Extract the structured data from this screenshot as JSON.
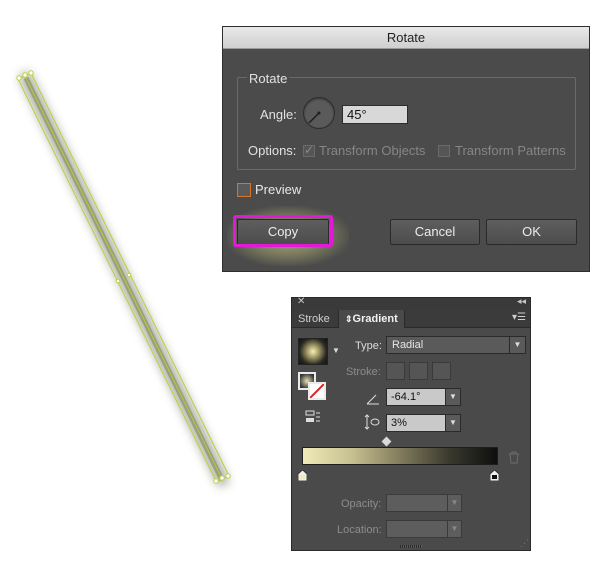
{
  "rotate_dialog": {
    "title": "Rotate",
    "group_label": "Rotate",
    "angle_label": "Angle:",
    "angle_value": "45°",
    "options_label": "Options:",
    "transform_objects_label": "Transform Objects",
    "transform_objects_checked": true,
    "transform_patterns_label": "Transform Patterns",
    "transform_patterns_checked": false,
    "preview_label": "Preview",
    "preview_checked": false,
    "copy_label": "Copy",
    "cancel_label": "Cancel",
    "ok_label": "OK",
    "highlight_color": "#e21ad8"
  },
  "gradient_panel": {
    "tabs": [
      {
        "label": "Stroke"
      },
      {
        "label": "Gradient",
        "active": true
      }
    ],
    "type_label": "Type:",
    "type_value": "Radial",
    "stroke_label": "Stroke:",
    "angle_value": "-64.1°",
    "aspect_value": "3%",
    "opacity_label": "Opacity:",
    "location_label": "Location:",
    "gradient_stops": [
      "#efeab6",
      "#0e0e0e"
    ],
    "icons": [
      "close-icon",
      "collapse-icon",
      "panel-menu-icon",
      "gradient-fill-swatch-icon",
      "reverse-gradient-icon",
      "angle-icon",
      "aspect-ratio-icon",
      "delete-stop-icon"
    ]
  },
  "artwork": {
    "stroke_color": "#b8d13a",
    "glow_color": "#7a7c6a"
  }
}
